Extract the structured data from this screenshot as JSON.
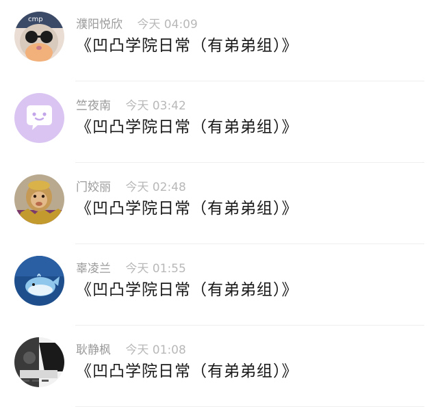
{
  "comments": [
    {
      "user": "濮阳悦欣",
      "time": "今天 04:09",
      "text": "《凹凸学院日常（有弟弟组）》",
      "avatar_icon": "cat-with-sunglasses-avatar"
    },
    {
      "user": "竺夜南",
      "time": "今天 03:42",
      "text": "《凹凸学院日常（有弟弟组）》",
      "avatar_icon": "purple-chat-bubble-avatar"
    },
    {
      "user": "门姣丽",
      "time": "今天 02:48",
      "text": "《凹凸学院日常（有弟弟组）》",
      "avatar_icon": "monkey-king-avatar"
    },
    {
      "user": "辜凌兰",
      "time": "今天 01:55",
      "text": "《凹凸学院日常（有弟弟组）》",
      "avatar_icon": "blue-whale-figurine-avatar"
    },
    {
      "user": "耿静枫",
      "time": "今天 01:08",
      "text": "《凹凸学院日常（有弟弟组）》",
      "avatar_icon": "dark-photo-avatar"
    }
  ],
  "colors": {
    "username": "#9a9a9a",
    "timestamp": "#b8b8b8",
    "comment_text": "#1a1a1a",
    "divider": "#eeeeee",
    "default_avatar": "#d9c4f2"
  }
}
